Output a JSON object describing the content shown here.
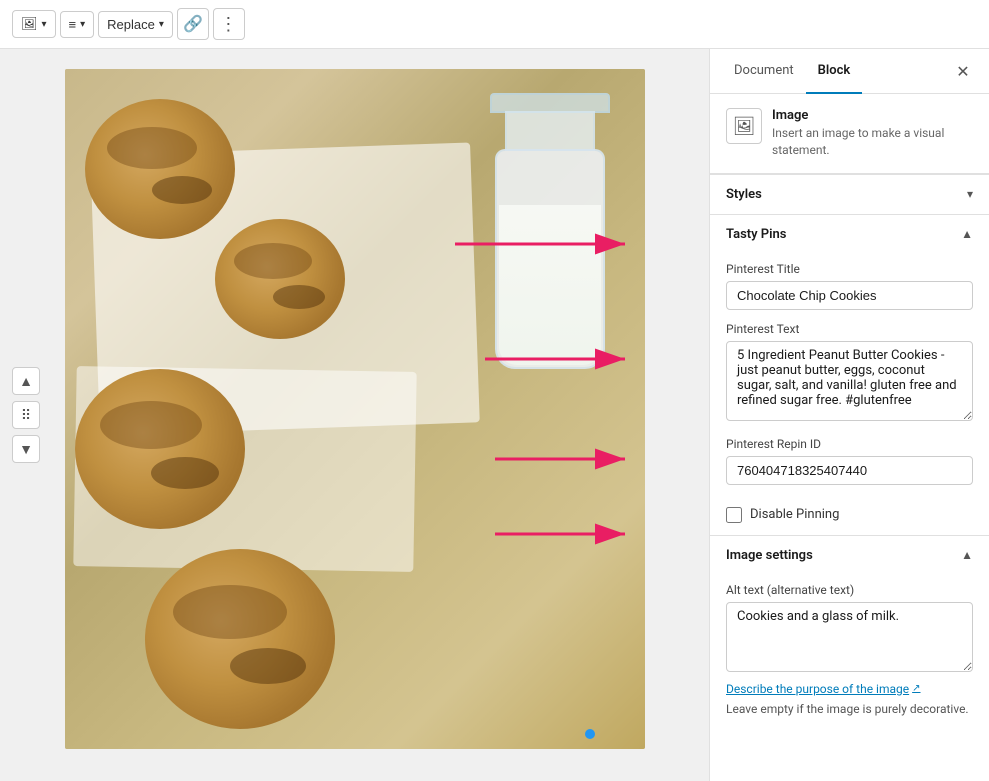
{
  "toolbar": {
    "image_icon": "🖼",
    "align_icon": "≡",
    "replace_label": "Replace",
    "replace_chevron": "▾",
    "link_icon": "🔗",
    "more_icon": "⋮"
  },
  "panel": {
    "document_tab": "Document",
    "block_tab": "Block",
    "close_label": "✕",
    "block_title": "Image",
    "block_description": "Insert an image to make a visual statement.",
    "block_icon": "🖼"
  },
  "styles_section": {
    "title": "Styles",
    "toggle": "▾"
  },
  "tasty_pins_section": {
    "title": "Tasty Pins",
    "toggle": "▲",
    "pinterest_title_label": "Pinterest Title",
    "pinterest_title_value": "Chocolate Chip Cookies",
    "pinterest_text_label": "Pinterest Text",
    "pinterest_text_value": "5 Ingredient Peanut Butter Cookies - just peanut butter, eggs, coconut sugar, salt, and vanilla! gluten free and refined sugar free. #glutenfree",
    "pinterest_repin_label": "Pinterest Repin ID",
    "pinterest_repin_value": "760404718325407440",
    "disable_pinning_label": "Disable Pinning"
  },
  "image_settings_section": {
    "title": "Image settings",
    "toggle": "▲",
    "alt_text_label": "Alt text (alternative text)",
    "alt_text_value": "Cookies and a glass of milk.",
    "describe_link": "Describe the purpose of the image",
    "decorative_note": "Leave empty if the image is purely decorative."
  },
  "arrows": [
    {
      "id": "arrow-pinterest-title",
      "label": "arrow to pinterest title"
    },
    {
      "id": "arrow-pinterest-text",
      "label": "arrow to pinterest text"
    },
    {
      "id": "arrow-pinterest-repin",
      "label": "arrow to pinterest repin"
    },
    {
      "id": "arrow-disable-pinning",
      "label": "arrow to disable pinning"
    }
  ]
}
